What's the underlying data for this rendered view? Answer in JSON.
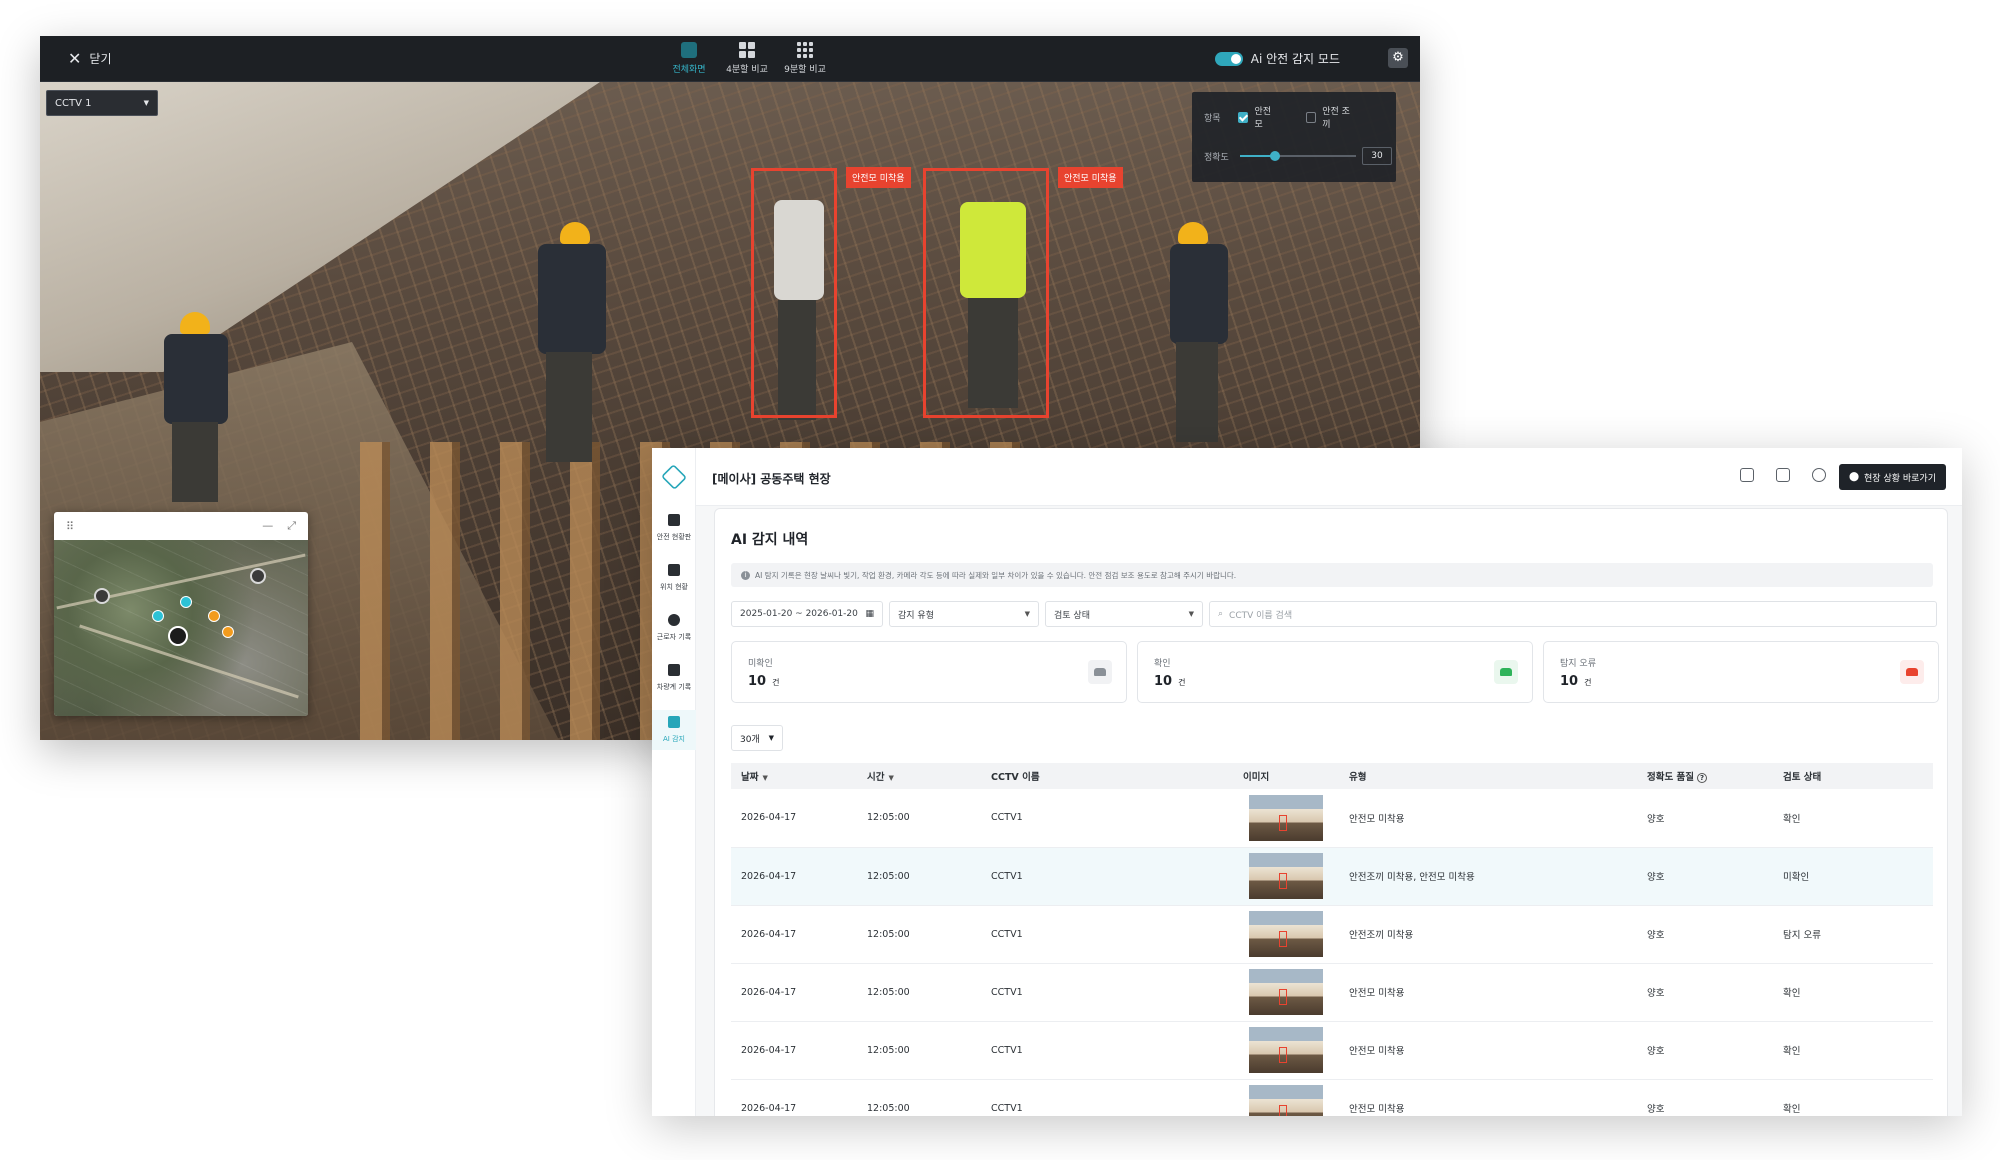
{
  "viewer": {
    "close_label": "닫기",
    "view_tabs": [
      {
        "label": "전체화면",
        "icon": "fullscreen-icon"
      },
      {
        "label": "4분할 비교",
        "icon": "grid-4-icon"
      },
      {
        "label": "9분할 비교",
        "icon": "grid-9-icon"
      }
    ],
    "ai_mode_label": "Ai 안전 감지 모드",
    "camera_select": "CCTV 1",
    "detection_panel": {
      "items_label": "항목",
      "option1": "안전모",
      "option2": "안전 조끼",
      "accuracy_label": "정확도",
      "accuracy_value": "30",
      "accuracy_fraction": 0.3
    },
    "bbox_labels": [
      "안전모 미착용",
      "안전모 미착용"
    ]
  },
  "dashboard": {
    "site_title": "[메이사] 공동주택 현장",
    "goto_button": "현장 상황 바로가기",
    "sidebar": [
      {
        "label": "안전 현황판",
        "icon": "chart-icon"
      },
      {
        "label": "위치 현황",
        "icon": "map-icon"
      },
      {
        "label": "근로자 기록",
        "icon": "clock-icon"
      },
      {
        "label": "차량계 기록",
        "icon": "truck-icon"
      },
      {
        "label": "AI 감지",
        "icon": "ai-car-icon"
      }
    ],
    "section_title": "AI 감지 내역",
    "notice": "AI 탐지 기록은 현장 날씨나 빛기, 작업 환경, 카메라 각도 등에 따라 실제와 일부 차이가 있을 수 있습니다. 안전 점검 보조 용도로 참고해 주시기 바랍니다.",
    "filters": {
      "date_range": "2025-01-20 ~ 2026-01-20",
      "detect_type": "감지 유형",
      "review_status": "검토 상태",
      "search_placeholder": "CCTV 이름 검색"
    },
    "stats": [
      {
        "label": "미확인",
        "value": "10",
        "unit": "건",
        "color": "#8a9097"
      },
      {
        "label": "확인",
        "value": "10",
        "unit": "건",
        "color": "#2fb35a"
      },
      {
        "label": "탐지 오류",
        "value": "10",
        "unit": "건",
        "color": "#e8432f"
      }
    ],
    "per_page": "30개",
    "table": {
      "headers": [
        "날짜",
        "시간",
        "CCTV 이름",
        "이미지",
        "유형",
        "정확도 품질",
        "검토 상태"
      ],
      "rows": [
        {
          "date": "2026-04-17",
          "time": "12:05:00",
          "cctv": "CCTV1",
          "type": "안전모 미착용",
          "quality": "양호",
          "status": "확인"
        },
        {
          "date": "2026-04-17",
          "time": "12:05:00",
          "cctv": "CCTV1",
          "type": "안전조끼 미착용, 안전모 미착용",
          "quality": "양호",
          "status": "미확인"
        },
        {
          "date": "2026-04-17",
          "time": "12:05:00",
          "cctv": "CCTV1",
          "type": "안전조끼 미착용",
          "quality": "양호",
          "status": "탐지 오류"
        },
        {
          "date": "2026-04-17",
          "time": "12:05:00",
          "cctv": "CCTV1",
          "type": "안전모 미착용",
          "quality": "양호",
          "status": "확인"
        },
        {
          "date": "2026-04-17",
          "time": "12:05:00",
          "cctv": "CCTV1",
          "type": "안전모 미착용",
          "quality": "양호",
          "status": "확인"
        },
        {
          "date": "2026-04-17",
          "time": "12:05:00",
          "cctv": "CCTV1",
          "type": "안전모 미착용",
          "quality": "양호",
          "status": "확인"
        }
      ]
    }
  },
  "colors": {
    "accent": "#26a6b9",
    "alert": "#e8432f",
    "dark": "#1d2024"
  }
}
